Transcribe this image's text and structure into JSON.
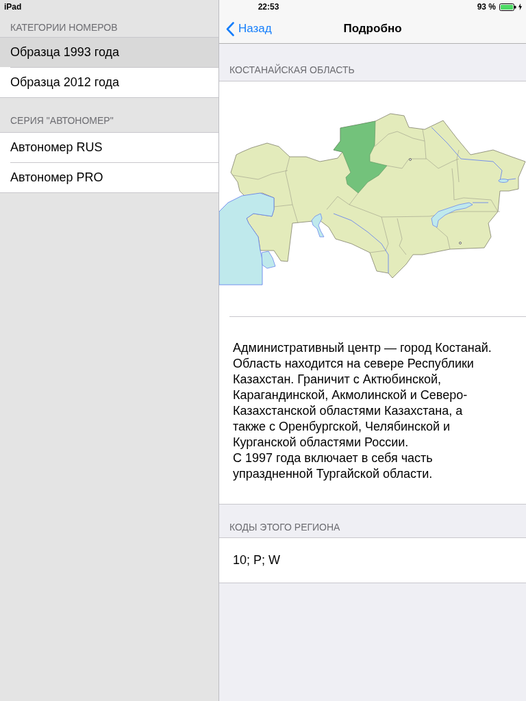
{
  "status_bar": {
    "device": "iPad",
    "time": "22:53",
    "battery": "93 %"
  },
  "sidebar": {
    "sections": [
      {
        "header": "КАТЕГОРИИ НОМЕРОВ",
        "items": [
          {
            "label": "Образца 1993 года",
            "selected": true
          },
          {
            "label": "Образца 2012 года",
            "selected": false
          }
        ]
      },
      {
        "header": "СЕРИЯ \"АВТОНОМЕР\"",
        "items": [
          {
            "label": "Автономер RUS",
            "selected": false
          },
          {
            "label": "Автономер PRO",
            "selected": false
          }
        ]
      }
    ]
  },
  "nav_bar": {
    "back": "Назад",
    "title": "Подробно"
  },
  "detail": {
    "region": {
      "header": "КОСТАНАЙСКАЯ ОБЛАСТЬ",
      "paragraphs": [
        "Административный центр — город Костанай. Область находится на севере Республики Казахстан. Граничит с Актюбинской, Карагандинской, Акмолинской и Северо-Казахстанской областями Казахстана, а также с Оренбургской, Челябинской и Курганской областями России.",
        "С 1997 года включает в себя часть упраздненной Тургайской области."
      ]
    },
    "codes": {
      "header": "КОДЫ ЭТОГО РЕГИОНА",
      "value": "10; P; W"
    }
  }
}
